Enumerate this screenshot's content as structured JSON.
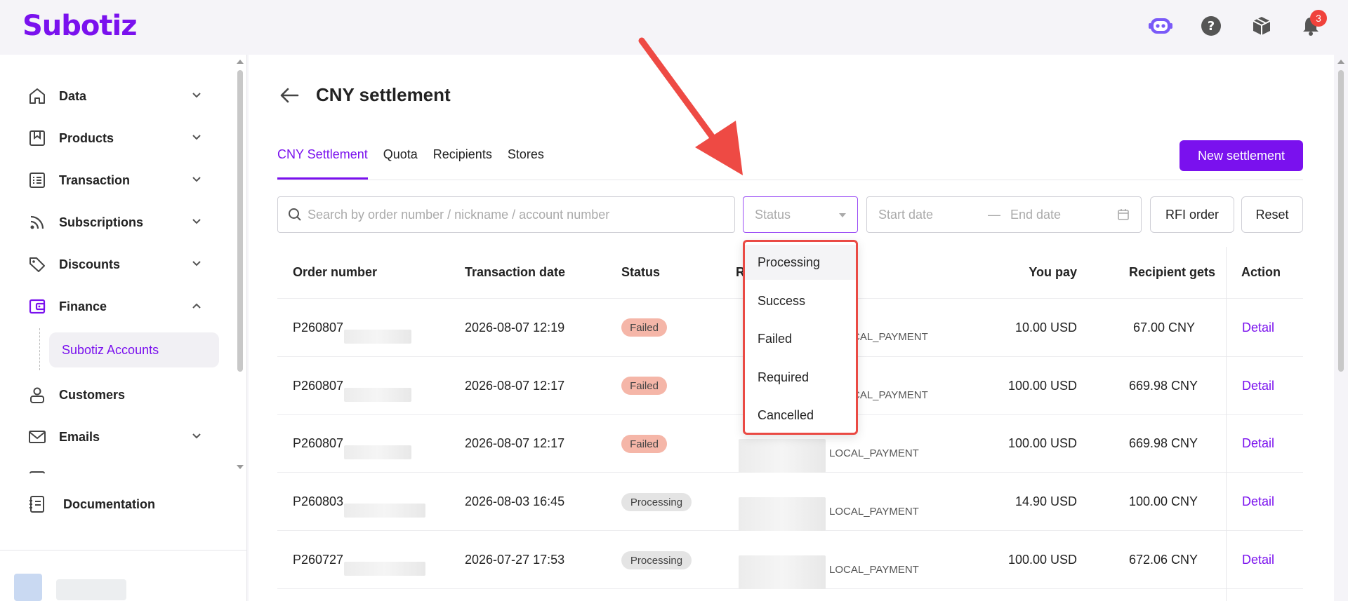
{
  "app": {
    "logo": "Subotiz",
    "notification_count": "3",
    "brand_color": "#7a11ee"
  },
  "sidebar": {
    "items": [
      {
        "label": "Data",
        "icon": "home-icon"
      },
      {
        "label": "Products",
        "icon": "bookmark-icon"
      },
      {
        "label": "Transaction",
        "icon": "list-icon"
      },
      {
        "label": "Subscriptions",
        "icon": "rss-icon"
      },
      {
        "label": "Discounts",
        "icon": "tag-icon"
      },
      {
        "label": "Finance",
        "icon": "wallet-icon"
      },
      {
        "label": "Customers",
        "icon": "user-icon"
      },
      {
        "label": "Emails",
        "icon": "mail-icon"
      }
    ],
    "finance_sub": "Subotiz Accounts",
    "documentation": "Documentation"
  },
  "page": {
    "title": "CNY settlement",
    "tabs": [
      "CNY Settlement",
      "Quota",
      "Recipients",
      "Stores"
    ],
    "new_button": "New settlement",
    "search_placeholder": "Search by order number / nickname / account number",
    "status_placeholder": "Status",
    "start_date": "Start date",
    "date_sep": "—",
    "end_date": "End date",
    "rfi_button": "RFI order",
    "reset_button": "Reset"
  },
  "table": {
    "headers": {
      "order": "Order number",
      "date": "Transaction date",
      "status": "Status",
      "recipient_partial": "R",
      "you_pay": "You pay",
      "gets": "Recipient gets",
      "action": "Action"
    },
    "rows": [
      {
        "order": "P260807",
        "date": "2026-08-07 12:19",
        "status": "Failed",
        "method": "LOCAL_PAYMENT",
        "pay": "10.00 USD",
        "gets": "67.00 CNY",
        "action": "Detail"
      },
      {
        "order": "P260807",
        "date": "2026-08-07 12:17",
        "status": "Failed",
        "method": "LOCAL_PAYMENT",
        "pay": "100.00 USD",
        "gets": "669.98 CNY",
        "action": "Detail"
      },
      {
        "order": "P260807",
        "date": "2026-08-07 12:17",
        "status": "Failed",
        "method": "LOCAL_PAYMENT",
        "pay": "100.00 USD",
        "gets": "669.98 CNY",
        "action": "Detail"
      },
      {
        "order": "P260803",
        "date": "2026-08-03 16:45",
        "status": "Processing",
        "method": "LOCAL_PAYMENT",
        "pay": "14.90 USD",
        "gets": "100.00 CNY",
        "action": "Detail"
      },
      {
        "order": "P260727",
        "date": "2026-07-27 17:53",
        "status": "Processing",
        "method": "LOCAL_PAYMENT",
        "pay": "100.00 USD",
        "gets": "672.06 CNY",
        "action": "Detail"
      }
    ],
    "method_visible_partial": "CAL_PAYMENT"
  },
  "dropdown": {
    "options": [
      "Processing",
      "Success",
      "Failed",
      "Required",
      "Cancelled"
    ]
  }
}
